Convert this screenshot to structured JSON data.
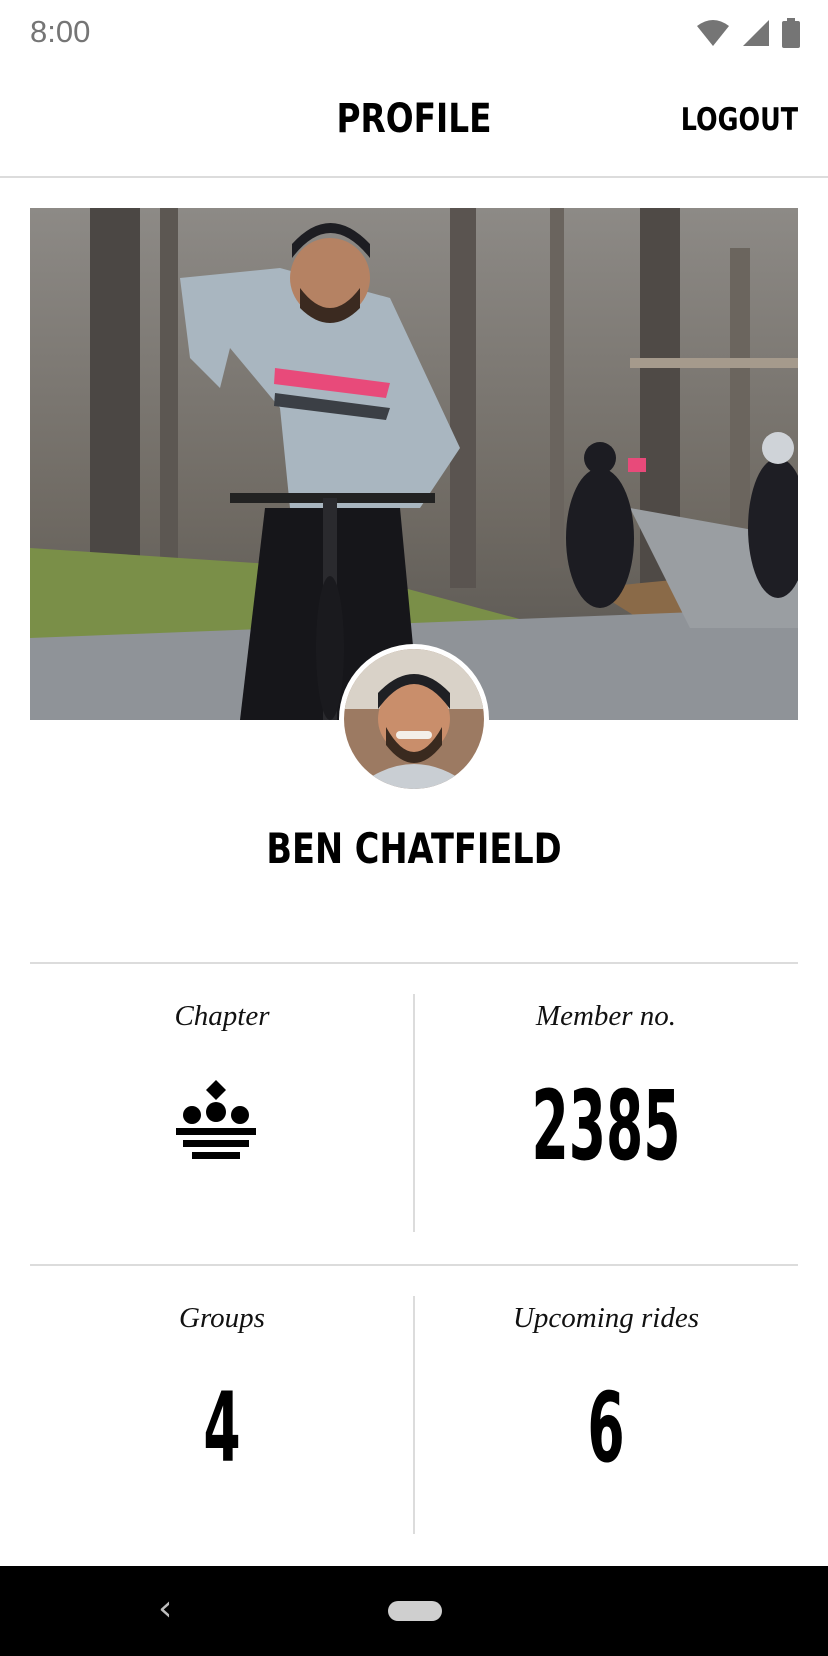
{
  "status_bar": {
    "time": "8:00",
    "icons": [
      "wifi-icon",
      "signal-icon",
      "battery-icon"
    ]
  },
  "app_bar": {
    "title": "PROFILE",
    "logout_label": "LOGOUT"
  },
  "profile": {
    "name": "BEN CHATFIELD"
  },
  "stats": {
    "chapter_label": "Chapter",
    "chapter_icon": "chapter-crown-icon",
    "member_label": "Member no.",
    "member_value": "2385",
    "groups_label": "Groups",
    "groups_value": "4",
    "rides_label": "Upcoming rides",
    "rides_value": "6"
  },
  "nav_bar": {
    "icons": [
      "back-icon",
      "home-pill-icon"
    ]
  },
  "colors": {
    "accent": "#e84a7a",
    "divider": "#dcdcdc",
    "nav_background": "#000000"
  }
}
